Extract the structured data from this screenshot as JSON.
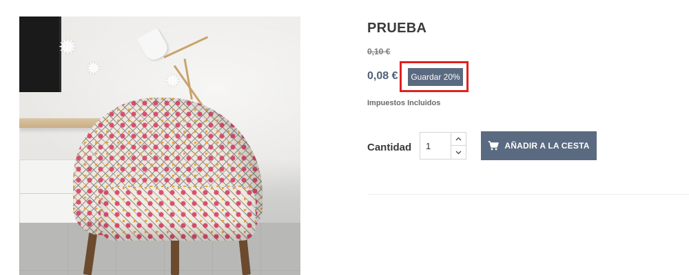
{
  "product": {
    "title": "PRUEBA",
    "image_alt": "chair-photo",
    "regular_price": "0,10 €",
    "price": "0,08 €",
    "discount_label": "Guardar 20%",
    "tax_note": "Impuestos Incluidos"
  },
  "quantity": {
    "label": "Cantidad",
    "value": "1"
  },
  "cart": {
    "add_label": "AÑADIR A LA CESTA"
  },
  "colors": {
    "accent": "#5a6a80",
    "price": "#4f5f76",
    "highlight": "#e02020"
  },
  "icons": [
    "shopping-cart-icon",
    "chevron-up-icon",
    "chevron-down-icon"
  ]
}
